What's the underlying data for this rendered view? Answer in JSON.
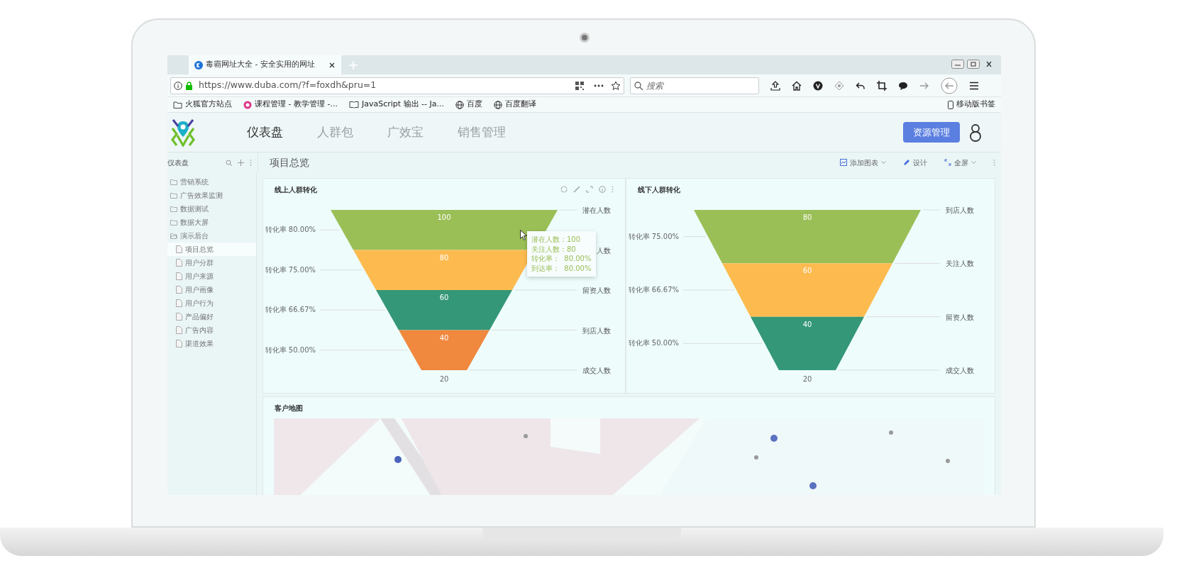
{
  "browser": {
    "tab_title": "毒霸网址大全 - 安全实用的网址",
    "url": "https://www.duba.com/?f=foxdh&pru=1",
    "search": {
      "placeholder": "搜索"
    },
    "bookmarks": [
      {
        "label": "火狐官方站点",
        "kind": "folder"
      },
      {
        "label": "课程管理 - 教学管理 -...",
        "kind": "site"
      },
      {
        "label": "JavaScript 输出 -- Ja...",
        "kind": "book"
      },
      {
        "label": "百度",
        "kind": "globe"
      },
      {
        "label": "百度翻译",
        "kind": "globe"
      }
    ],
    "mobile_bookmarks": "移动版书签"
  },
  "app": {
    "nav": [
      {
        "label": "仪表盘",
        "selected": true
      },
      {
        "label": "人群包",
        "selected": false
      },
      {
        "label": "广效宝",
        "selected": false
      },
      {
        "label": "销售管理",
        "selected": false
      }
    ],
    "resource_button": "资源管理"
  },
  "sidebar": {
    "title": "仪表盘",
    "items": [
      {
        "label": "营销系统",
        "expanded": false
      },
      {
        "label": "广告效果监测",
        "expanded": false
      },
      {
        "label": "数据测试",
        "expanded": false
      },
      {
        "label": "数据大屏",
        "expanded": false
      },
      {
        "label": "演示后台",
        "expanded": true,
        "children": [
          {
            "label": "项目总览",
            "selected": true
          },
          {
            "label": "用户分群",
            "selected": false
          },
          {
            "label": "用户来源",
            "selected": false
          },
          {
            "label": "用户画像",
            "selected": false
          },
          {
            "label": "用户行为",
            "selected": false
          },
          {
            "label": "产品偏好",
            "selected": false
          },
          {
            "label": "广告内容",
            "selected": false
          },
          {
            "label": "渠道效果",
            "selected": false
          }
        ]
      }
    ]
  },
  "page_title": "项目总览",
  "toolbar": [
    {
      "label": "添加图表",
      "kind": "add",
      "dropdown": true
    },
    {
      "label": "设计",
      "kind": "design",
      "dropdown": false
    },
    {
      "label": "全屏",
      "kind": "fullscreen",
      "dropdown": true
    }
  ],
  "charts": [
    {
      "title": "线上人群转化",
      "tools": true,
      "stages": [
        {
          "label": "潜在人数",
          "value": "100",
          "color": "#9bbf57"
        },
        {
          "label": "人数",
          "value": "80",
          "color": "#fdbb4f"
        },
        {
          "label": "留资人数",
          "value": "60",
          "color": "#349777"
        },
        {
          "label": "到店人数",
          "value": "40",
          "color": "#f0883e"
        },
        {
          "label": "成交人数",
          "value": "20"
        }
      ],
      "conversions": [
        "转化率 80.00%",
        "转化率 75.00%",
        "转化率 66.67%",
        "转化率 50.00%"
      ],
      "tooltip": [
        "潜在人数：100",
        "关注人数：80",
        "转化率：  80.00%",
        "到达率：  80.00%"
      ]
    },
    {
      "title": "线下人群转化",
      "tools": false,
      "stages": [
        {
          "label": "到店人数",
          "value": "80",
          "color": "#9bbf57"
        },
        {
          "label": "关注人数",
          "value": "60",
          "color": "#fdbb4f"
        },
        {
          "label": "留资人数",
          "value": "40",
          "color": "#349777"
        },
        {
          "label": "成交人数",
          "value": "20"
        }
      ],
      "conversions": [
        "转化率 75.00%",
        "转化率 66.67%",
        "转化率 50.00%"
      ]
    }
  ],
  "map": {
    "title": "客户地图",
    "kind": "picture"
  }
}
